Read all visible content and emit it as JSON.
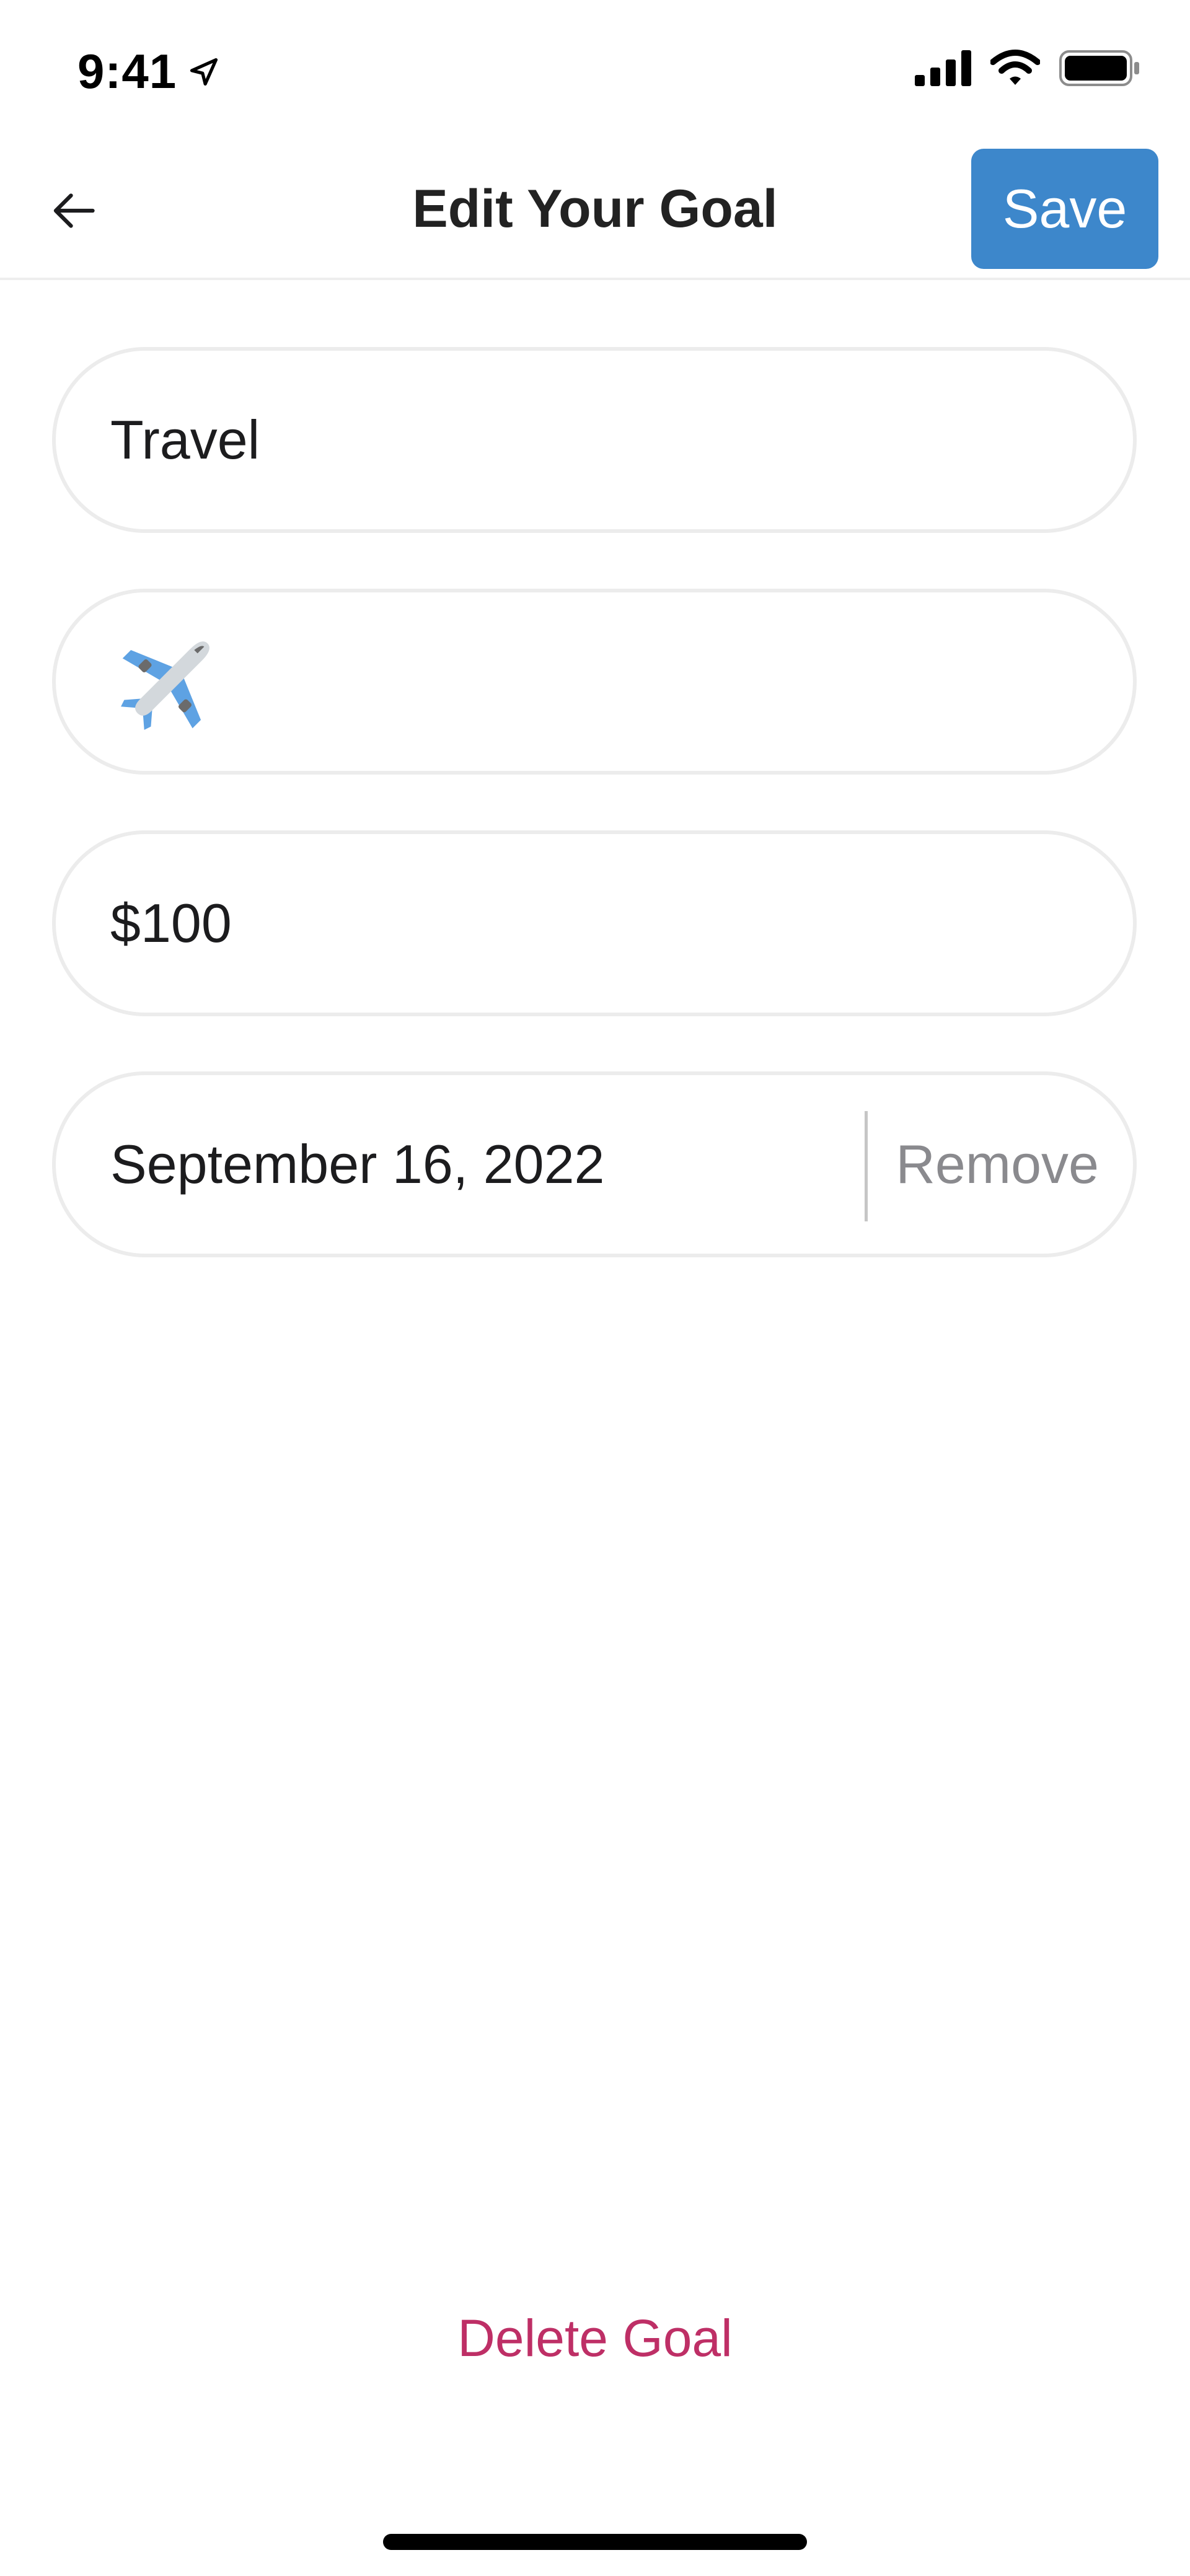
{
  "status_bar": {
    "time": "9:41"
  },
  "header": {
    "title": "Edit Your Goal",
    "save_label": "Save"
  },
  "form": {
    "name_value": "Travel",
    "icon_value": "airplane-emoji",
    "amount_value": "$100",
    "date_value": "September 16, 2022",
    "remove_label": "Remove"
  },
  "footer": {
    "delete_label": "Delete Goal"
  },
  "colors": {
    "accent": "#3d87cb",
    "danger": "#be2f66",
    "field_border": "#ececec",
    "muted_text": "#8a8a8e"
  },
  "icons": {
    "back": "arrow-left-icon",
    "location": "location-arrow-icon",
    "signal": "cellular-signal-icon",
    "wifi": "wifi-icon",
    "battery": "battery-icon",
    "goal_icon": "airplane-icon"
  }
}
